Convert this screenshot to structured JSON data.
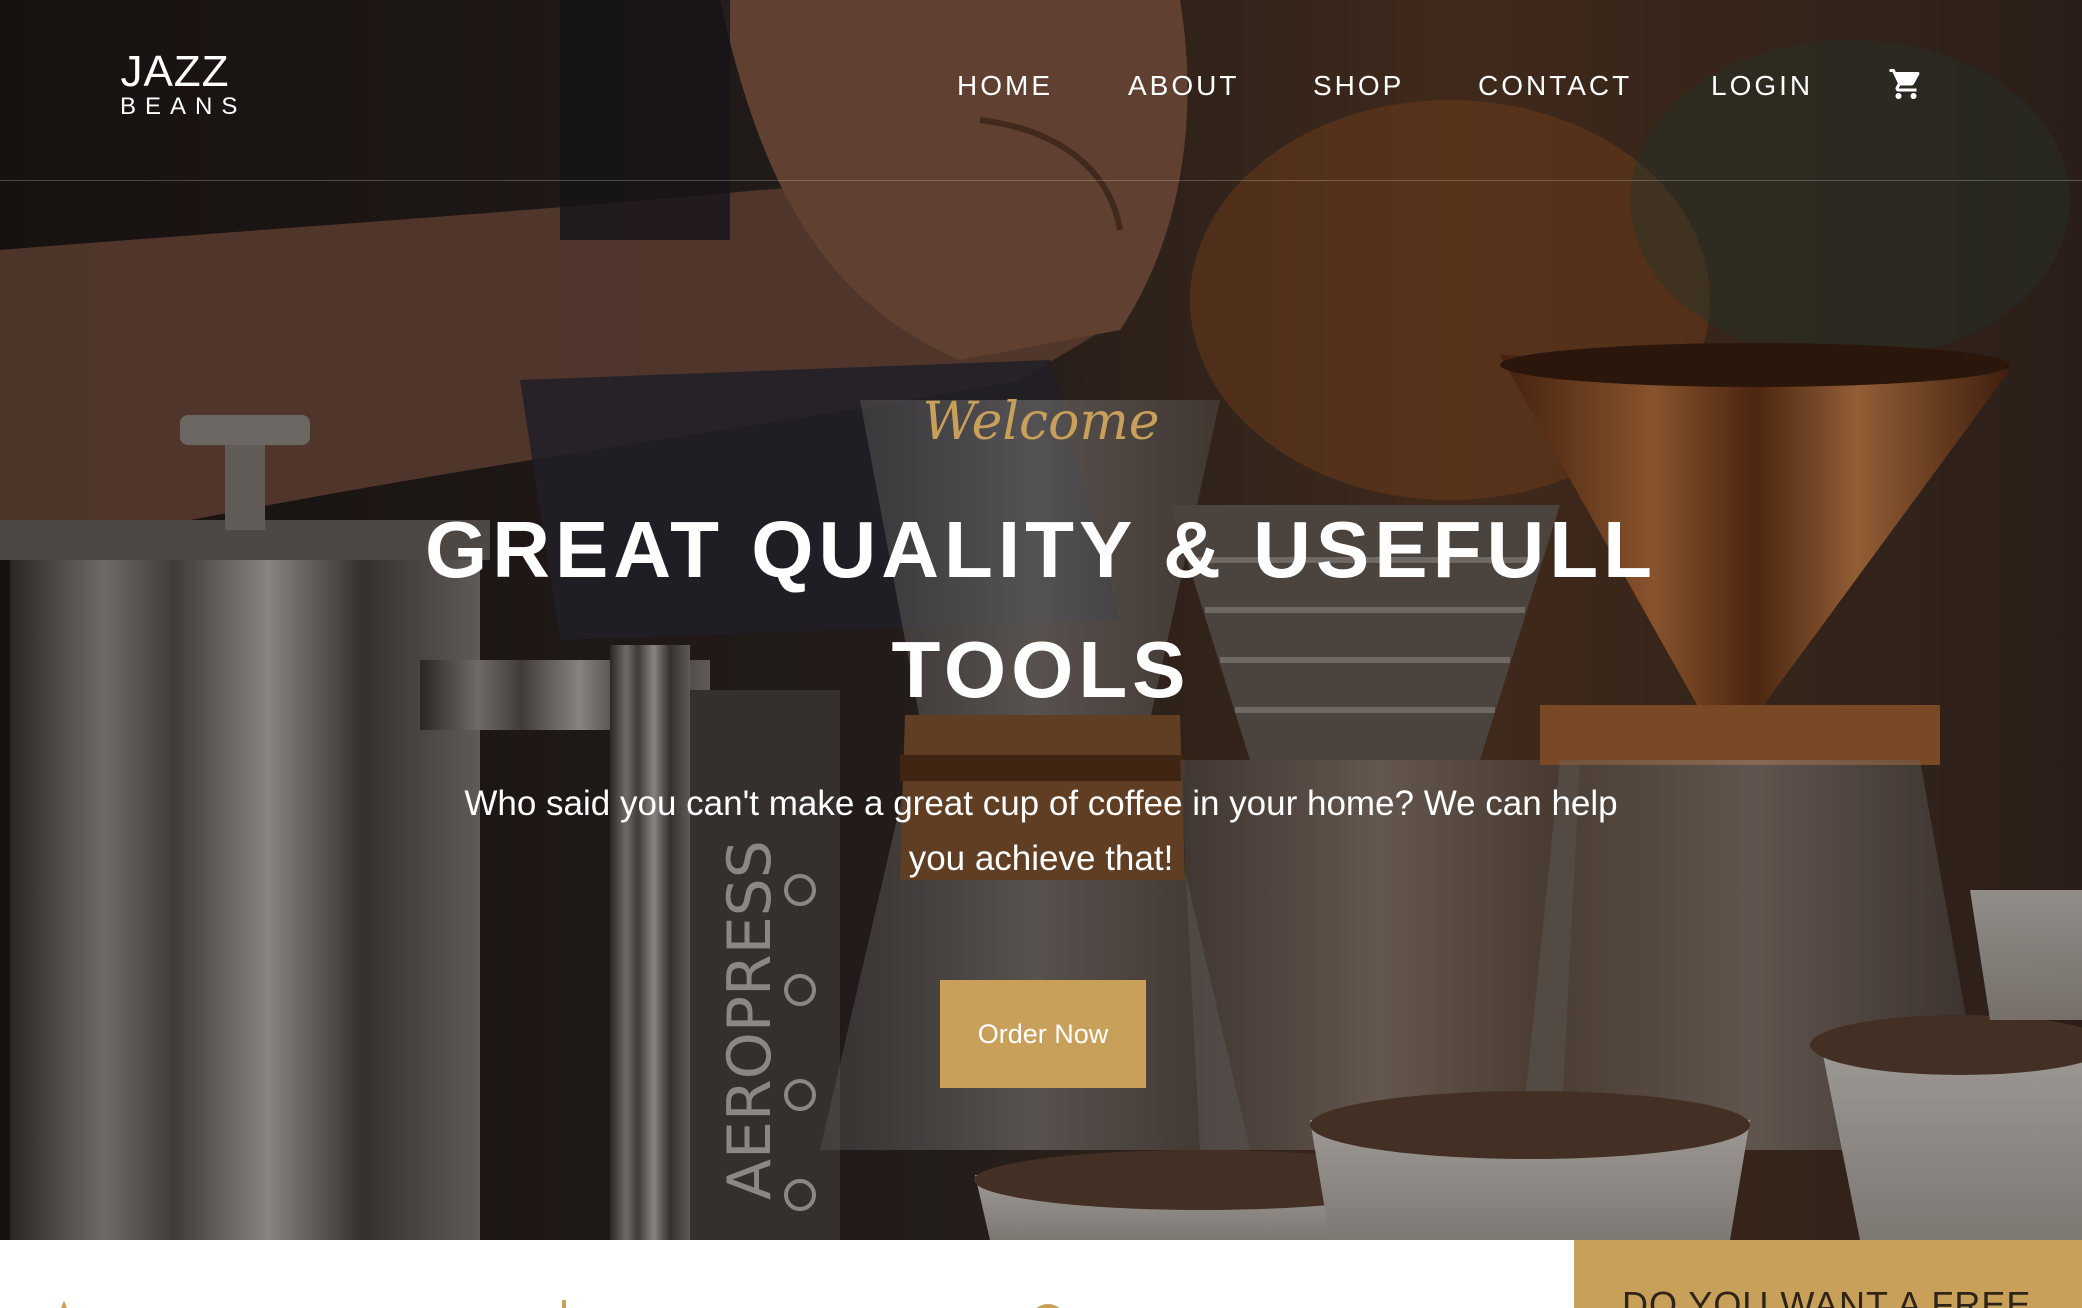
{
  "brand": {
    "name_top": "JAZZ",
    "name_bottom": "BEANS"
  },
  "nav": {
    "items": [
      {
        "label": "HOME"
      },
      {
        "label": "ABOUT"
      },
      {
        "label": "SHOP"
      },
      {
        "label": "CONTACT"
      },
      {
        "label": "LOGIN"
      }
    ],
    "cart_icon": "cart-icon"
  },
  "hero": {
    "welcome": "Welcome",
    "title": "GREAT QUALITY & USEFULL TOOLS",
    "subtitle": "Who said you can't make a great cup of coffee in your home? We can help you achieve that!",
    "cta_label": "Order Now"
  },
  "promo": {
    "text": "DO YOU WANT A FREE"
  },
  "colors": {
    "accent": "#c9a05a",
    "text_light": "#ffffff",
    "promo_text": "#2e2418"
  },
  "features": {
    "icons": [
      "feature-icon-1",
      "feature-icon-2",
      "feature-icon-3"
    ]
  }
}
